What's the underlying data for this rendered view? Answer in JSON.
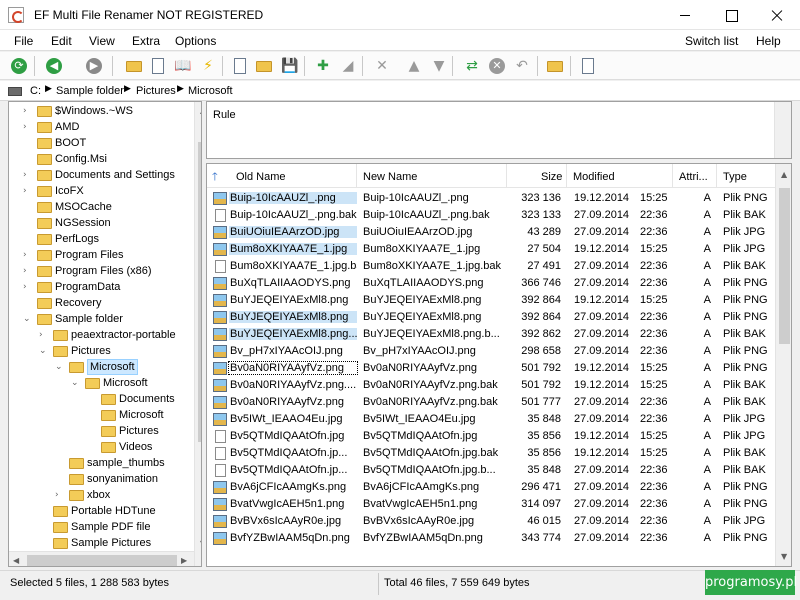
{
  "window": {
    "title": "EF Multi File Renamer NOT REGISTERED"
  },
  "menu": {
    "items": [
      "File",
      "Edit",
      "View",
      "Extra",
      "Options"
    ],
    "right_items": [
      "Switch list",
      "Help"
    ]
  },
  "toolbar": {
    "buttons": [
      {
        "name": "refresh-icon",
        "kind": "circle",
        "color": "#2f9e44",
        "glyph": "⟳"
      },
      {
        "name": "back-icon",
        "kind": "circle",
        "color": "#2f9e44",
        "glyph": "◀"
      },
      {
        "name": "forward-icon",
        "kind": "circle",
        "color": "#8a8a8a",
        "glyph": "▶"
      },
      {
        "name": "open-folder-icon",
        "kind": "folder"
      },
      {
        "name": "checklist-icon",
        "kind": "doc"
      },
      {
        "name": "book-icon",
        "kind": "glyph",
        "glyph": "📖"
      },
      {
        "name": "lightning-icon",
        "kind": "glyph",
        "glyph": "⚡",
        "color": "#e7b800"
      },
      {
        "name": "new-file-icon",
        "kind": "doc"
      },
      {
        "name": "open-file-icon",
        "kind": "folder"
      },
      {
        "name": "save-icon",
        "kind": "glyph",
        "glyph": "💾"
      },
      {
        "name": "add-icon",
        "kind": "glyph",
        "glyph": "✚",
        "color": "#2f9e44"
      },
      {
        "name": "edit-icon",
        "kind": "glyph",
        "glyph": "◢",
        "color": "#9a9a9a"
      },
      {
        "name": "delete-icon",
        "kind": "glyph",
        "glyph": "✕",
        "color": "#9a9a9a"
      },
      {
        "name": "move-up-icon",
        "kind": "glyph",
        "glyph": "▲",
        "color": "#9a9a9a"
      },
      {
        "name": "move-down-icon",
        "kind": "glyph",
        "glyph": "▼",
        "color": "#9a9a9a"
      },
      {
        "name": "rename-icon",
        "kind": "glyph",
        "glyph": "⇄",
        "color": "#2f9e44"
      },
      {
        "name": "cancel-icon",
        "kind": "circle",
        "color": "#9a9a9a",
        "glyph": "✕"
      },
      {
        "name": "undo-icon",
        "kind": "glyph",
        "glyph": "↶",
        "color": "#9a9a9a"
      },
      {
        "name": "folder-icon",
        "kind": "folder"
      },
      {
        "name": "settings-doc-icon",
        "kind": "doc"
      }
    ]
  },
  "path": {
    "segments": [
      "C:",
      "Sample folder",
      "Pictures",
      "Microsoft"
    ]
  },
  "tree": {
    "items": [
      {
        "label": "$Windows.~WS",
        "level": 2,
        "expander": "›"
      },
      {
        "label": "AMD",
        "level": 2,
        "expander": "›"
      },
      {
        "label": "BOOT",
        "level": 2,
        "expander": ""
      },
      {
        "label": "Config.Msi",
        "level": 2,
        "expander": ""
      },
      {
        "label": "Documents and Settings",
        "level": 2,
        "expander": "›"
      },
      {
        "label": "IcoFX",
        "level": 2,
        "expander": "›"
      },
      {
        "label": "MSOCache",
        "level": 2,
        "expander": ""
      },
      {
        "label": "NGSession",
        "level": 2,
        "expander": ""
      },
      {
        "label": "PerfLogs",
        "level": 2,
        "expander": ""
      },
      {
        "label": "Program Files",
        "level": 2,
        "expander": "›"
      },
      {
        "label": "Program Files (x86)",
        "level": 2,
        "expander": "›"
      },
      {
        "label": "ProgramData",
        "level": 2,
        "expander": "›"
      },
      {
        "label": "Recovery",
        "level": 2,
        "expander": ""
      },
      {
        "label": "Sample folder",
        "level": 2,
        "expander": "⌄"
      },
      {
        "label": "peaextractor-portable",
        "level": 3,
        "expander": "›"
      },
      {
        "label": "Pictures",
        "level": 3,
        "expander": "⌄"
      },
      {
        "label": "Microsoft",
        "level": 4,
        "expander": "⌄",
        "selected": true
      },
      {
        "label": "Microsoft",
        "level": 5,
        "expander": "⌄"
      },
      {
        "label": "Documents",
        "level": 6,
        "expander": ""
      },
      {
        "label": "Microsoft",
        "level": 6,
        "expander": ""
      },
      {
        "label": "Pictures",
        "level": 6,
        "expander": ""
      },
      {
        "label": "Videos",
        "level": 6,
        "expander": ""
      },
      {
        "label": "sample_thumbs",
        "level": 4,
        "expander": ""
      },
      {
        "label": "sonyanimation",
        "level": 4,
        "expander": ""
      },
      {
        "label": "xbox",
        "level": 4,
        "expander": "›"
      },
      {
        "label": "Portable HDTune",
        "level": 3,
        "expander": ""
      },
      {
        "label": "Sample PDF file",
        "level": 3,
        "expander": ""
      },
      {
        "label": "Sample Pictures",
        "level": 3,
        "expander": ""
      }
    ]
  },
  "rule_panel": {
    "label": "Rule"
  },
  "file_list": {
    "headers": {
      "old": "Old Name",
      "new": "New Name",
      "size": "Size",
      "modified": "Modified",
      "attr": "Attri...",
      "type": "Type"
    },
    "rows": [
      {
        "icon": "img",
        "old": "Buip-10IcAAUZl_.png",
        "new": "Buip-10IcAAUZl_.png",
        "size": "323 136",
        "date": "19.12.2014",
        "time": "15:25",
        "attr": "A",
        "type": "Plik PNG",
        "selected": true
      },
      {
        "icon": "bak",
        "old": "Buip-10IcAAUZl_.png.bak",
        "new": "Buip-10IcAAUZl_.png.bak",
        "size": "323 133",
        "date": "27.09.2014",
        "time": "22:36",
        "attr": "A",
        "type": "Plik BAK"
      },
      {
        "icon": "img",
        "old": "BuiUOiuIEAArzOD.jpg",
        "new": "BuiUOiuIEAArzOD.jpg",
        "size": "43 289",
        "date": "27.09.2014",
        "time": "22:36",
        "attr": "A",
        "type": "Plik JPG",
        "selected": true
      },
      {
        "icon": "img",
        "old": "Bum8oXKIYAA7E_1.jpg",
        "new": "Bum8oXKIYAA7E_1.jpg",
        "size": "27 504",
        "date": "19.12.2014",
        "time": "15:25",
        "attr": "A",
        "type": "Plik JPG",
        "selected": true
      },
      {
        "icon": "bak",
        "old": "Bum8oXKIYAA7E_1.jpg.bak",
        "new": "Bum8oXKIYAA7E_1.jpg.bak",
        "size": "27 491",
        "date": "27.09.2014",
        "time": "22:36",
        "attr": "A",
        "type": "Plik BAK"
      },
      {
        "icon": "img",
        "old": "BuXqTLAIIAAODYS.png",
        "new": "BuXqTLAIIAAODYS.png",
        "size": "366 746",
        "date": "27.09.2014",
        "time": "22:36",
        "attr": "A",
        "type": "Plik PNG"
      },
      {
        "icon": "img",
        "old": "BuYJEQEIYAExMl8.png",
        "new": "BuYJEQEIYAExMl8.png",
        "size": "392 864",
        "date": "19.12.2014",
        "time": "15:25",
        "attr": "A",
        "type": "Plik PNG"
      },
      {
        "icon": "img",
        "old": "BuYJEQEIYAExMl8.png",
        "new": "BuYJEQEIYAExMl8.png",
        "size": "392 864",
        "date": "27.09.2014",
        "time": "22:36",
        "attr": "A",
        "type": "Plik PNG",
        "selected": true
      },
      {
        "icon": "img",
        "old": "BuYJEQEIYAExMl8.png....",
        "new": "BuYJEQEIYAExMl8.png.b...",
        "size": "392 862",
        "date": "27.09.2014",
        "time": "22:36",
        "attr": "A",
        "type": "Plik BAK",
        "selected": true
      },
      {
        "icon": "img",
        "old": "Bv_pH7xIYAAcOIJ.png",
        "new": "Bv_pH7xIYAAcOIJ.png",
        "size": "298 658",
        "date": "27.09.2014",
        "time": "22:36",
        "attr": "A",
        "type": "Plik PNG"
      },
      {
        "icon": "img",
        "old": "Bv0aN0RIYAAyfVz.png",
        "new": "Bv0aN0RIYAAyfVz.png",
        "size": "501 792",
        "date": "19.12.2014",
        "time": "15:25",
        "attr": "A",
        "type": "Plik PNG",
        "focus": true
      },
      {
        "icon": "img",
        "old": "Bv0aN0RIYAAyfVz.png....",
        "new": "Bv0aN0RIYAAyfVz.png.bak",
        "size": "501 792",
        "date": "19.12.2014",
        "time": "15:25",
        "attr": "A",
        "type": "Plik BAK"
      },
      {
        "icon": "img",
        "old": "Bv0aN0RIYAAyfVz.png",
        "new": "Bv0aN0RIYAAyfVz.png.bak",
        "size": "501 777",
        "date": "27.09.2014",
        "time": "22:36",
        "attr": "A",
        "type": "Plik BAK"
      },
      {
        "icon": "img",
        "old": "Bv5IWt_IEAAO4Eu.jpg",
        "new": "Bv5IWt_IEAAO4Eu.jpg",
        "size": "35 848",
        "date": "27.09.2014",
        "time": "22:36",
        "attr": "A",
        "type": "Plik JPG"
      },
      {
        "icon": "bak",
        "old": "Bv5QTMdIQAAtOfn.jpg",
        "new": "Bv5QTMdIQAAtOfn.jpg",
        "size": "35 856",
        "date": "19.12.2014",
        "time": "15:25",
        "attr": "A",
        "type": "Plik JPG"
      },
      {
        "icon": "bak",
        "old": "Bv5QTMdIQAAtOfn.jp...",
        "new": "Bv5QTMdIQAAtOfn.jpg.bak",
        "size": "35 856",
        "date": "19.12.2014",
        "time": "15:25",
        "attr": "A",
        "type": "Plik BAK"
      },
      {
        "icon": "bak",
        "old": "Bv5QTMdIQAAtOfn.jp...",
        "new": "Bv5QTMdIQAAtOfn.jpg.b...",
        "size": "35 848",
        "date": "27.09.2014",
        "time": "22:36",
        "attr": "A",
        "type": "Plik BAK"
      },
      {
        "icon": "img",
        "old": "BvA6jCFIcAAmgKs.png",
        "new": "BvA6jCFIcAAmgKs.png",
        "size": "296 471",
        "date": "27.09.2014",
        "time": "22:36",
        "attr": "A",
        "type": "Plik PNG"
      },
      {
        "icon": "img",
        "old": "BvatVwgIcAEH5n1.png",
        "new": "BvatVwgIcAEH5n1.png",
        "size": "314 097",
        "date": "27.09.2014",
        "time": "22:36",
        "attr": "A",
        "type": "Plik PNG"
      },
      {
        "icon": "img",
        "old": "BvBVx6sIcAAyR0e.jpg",
        "new": "BvBVx6sIcAAyR0e.jpg",
        "size": "46 015",
        "date": "27.09.2014",
        "time": "22:36",
        "attr": "A",
        "type": "Plik JPG"
      },
      {
        "icon": "img",
        "old": "BvfYZBwIAAM5qDn.png",
        "new": "BvfYZBwIAAM5qDn.png",
        "size": "343 774",
        "date": "27.09.2014",
        "time": "22:36",
        "attr": "A",
        "type": "Plik PNG"
      }
    ]
  },
  "status": {
    "selected": "Selected 5 files, 1 288 583 bytes",
    "total": "Total 46 files, 7 559 649 bytes"
  },
  "watermark": {
    "text": "programosy.pl"
  }
}
